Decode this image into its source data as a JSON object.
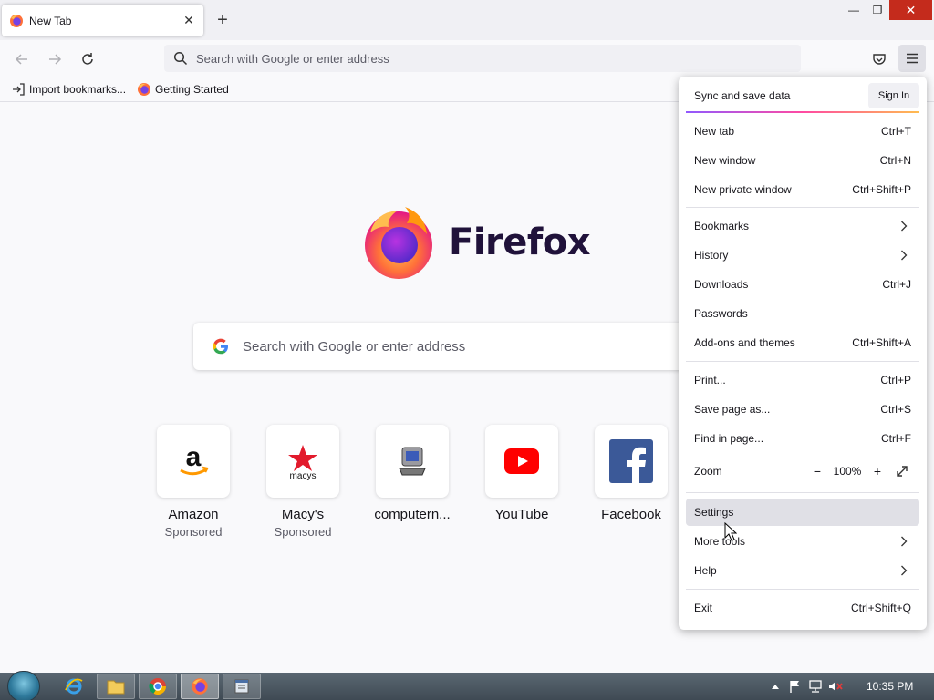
{
  "browser": {
    "tab": {
      "title": "New Tab",
      "close_glyph": "✕"
    },
    "new_tab_glyph": "+",
    "window_controls": {
      "minimize": "—",
      "maximize": "❐",
      "close": "✕"
    },
    "address_bar": {
      "placeholder": "Search with Google or enter address"
    },
    "bookmarks": [
      {
        "label": "Import bookmarks...",
        "icon": "import-icon"
      },
      {
        "label": "Getting Started",
        "icon": "firefox-icon"
      }
    ]
  },
  "newtab": {
    "brand": "Firefox",
    "search_placeholder": "Search with Google or enter address",
    "tiles": [
      {
        "name": "Amazon",
        "sub": "Sponsored",
        "icon": "amazon-icon"
      },
      {
        "name": "Macy's",
        "sub": "Sponsored",
        "icon": "macys-icon"
      },
      {
        "name": "computern...",
        "sub": "",
        "icon": "computer-icon"
      },
      {
        "name": "YouTube",
        "sub": "",
        "icon": "youtube-icon"
      },
      {
        "name": "Facebook",
        "sub": "",
        "icon": "facebook-icon"
      }
    ]
  },
  "app_menu": {
    "header": {
      "label": "Sync and save data",
      "signin": "Sign In"
    },
    "items": [
      {
        "label": "New tab",
        "shortcut": "Ctrl+T"
      },
      {
        "label": "New window",
        "shortcut": "Ctrl+N"
      },
      {
        "label": "New private window",
        "shortcut": "Ctrl+Shift+P"
      },
      {
        "label": "Bookmarks",
        "shortcut": ""
      },
      {
        "label": "History",
        "shortcut": ""
      },
      {
        "label": "Downloads",
        "shortcut": "Ctrl+J"
      },
      {
        "label": "Passwords",
        "shortcut": ""
      },
      {
        "label": "Add-ons and themes",
        "shortcut": "Ctrl+Shift+A"
      },
      {
        "label": "Print...",
        "shortcut": "Ctrl+P"
      },
      {
        "label": "Save page as...",
        "shortcut": "Ctrl+S"
      },
      {
        "label": "Find in page...",
        "shortcut": "Ctrl+F"
      },
      {
        "label": "Zoom",
        "shortcut": ""
      },
      {
        "label": "Settings",
        "shortcut": ""
      },
      {
        "label": "More tools",
        "shortcut": ""
      },
      {
        "label": "Help",
        "shortcut": ""
      },
      {
        "label": "Exit",
        "shortcut": "Ctrl+Shift+Q"
      }
    ],
    "zoom": {
      "minus": "−",
      "value": "100%",
      "plus": "+"
    }
  },
  "taskbar": {
    "clock": "10:35 PM"
  },
  "colors": {
    "accent": "#c42b1c",
    "menu_hover": "#e0e0e6",
    "brand_text": "#20123a"
  }
}
